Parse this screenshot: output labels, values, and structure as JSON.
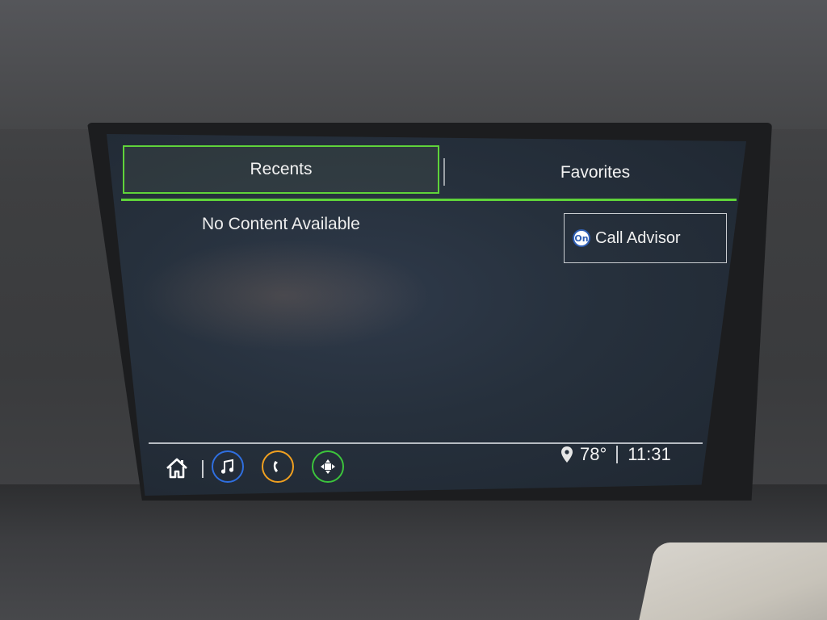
{
  "tabs": {
    "recents_label": "Recents",
    "favorites_label": "Favorites"
  },
  "content": {
    "empty_message": "No Content Available"
  },
  "advisor": {
    "icon_text": "On",
    "label": "Call Advisor"
  },
  "bottom_bar": {
    "icons": [
      "home-icon",
      "audio-icon",
      "phone-icon",
      "apps-icon"
    ],
    "temperature": "78°",
    "time": "11:31"
  },
  "colors": {
    "accent_green": "#5fd33a",
    "audio_blue": "#2f6fe0",
    "phone_orange": "#f0a020",
    "apps_green": "#3cc43c",
    "onstar_blue": "#2f5fb5"
  }
}
